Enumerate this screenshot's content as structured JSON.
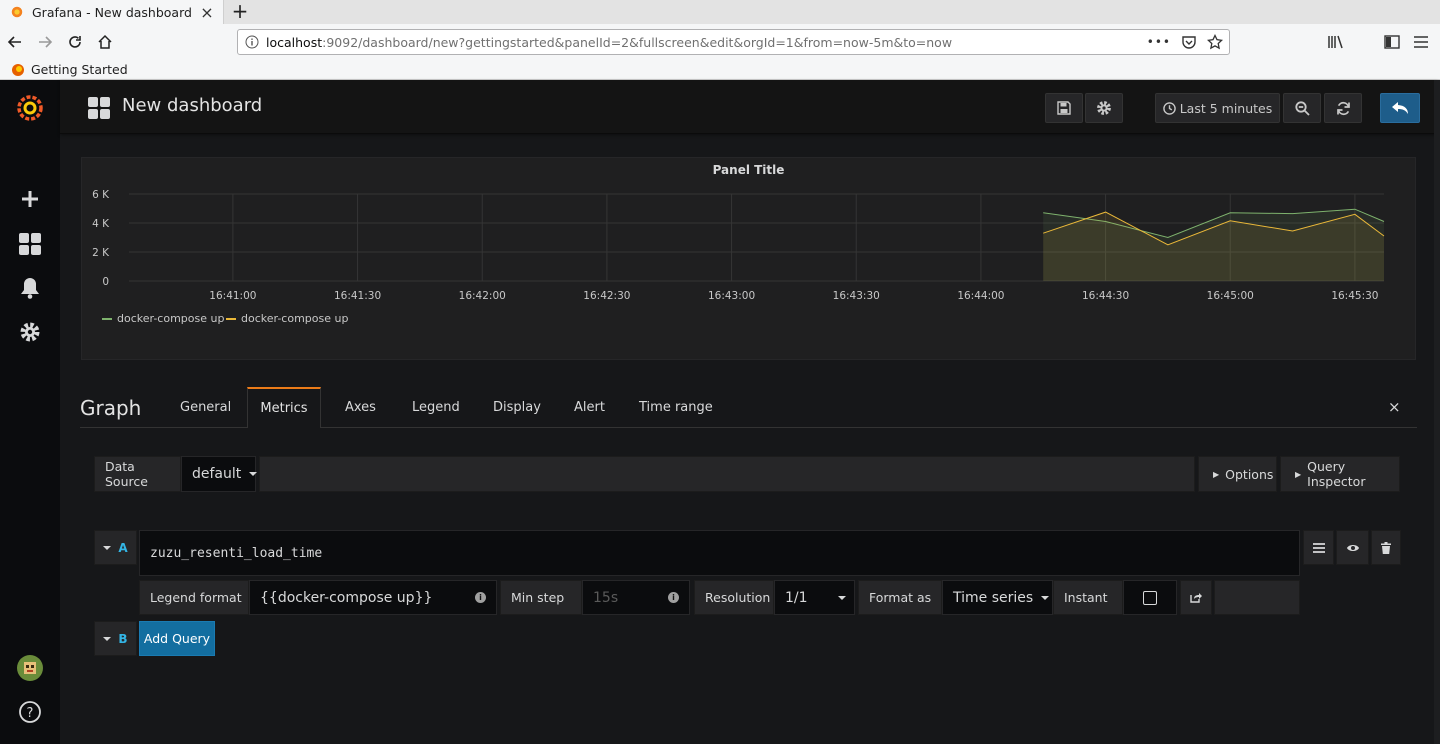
{
  "browser": {
    "tab_title": "Grafana - New dashboard",
    "url_host": "localhost",
    "url_rest": ":9092/dashboard/new?gettingstarted&panelId=2&fullscreen&edit&orgId=1&from=now-5m&to=now",
    "url_more": "•••",
    "bookmark": "Getting Started"
  },
  "header": {
    "title": "New dashboard",
    "time_range": "Last 5 minutes"
  },
  "panel": {
    "title": "Panel Title"
  },
  "chart_data": {
    "type": "line",
    "title": "Panel Title",
    "xlabel": "",
    "ylabel": "",
    "y_ticks": [
      "0",
      "2 K",
      "4 K",
      "6 K"
    ],
    "x_ticks": [
      "16:41:00",
      "16:41:30",
      "16:42:00",
      "16:42:30",
      "16:43:00",
      "16:43:30",
      "16:44:00",
      "16:44:30",
      "16:45:00",
      "16:45:30"
    ],
    "ylim": [
      0,
      6000
    ],
    "xlim": [
      "16:40:35",
      "16:45:37"
    ],
    "grid": true,
    "legend_position": "bottom-left",
    "x": [
      "16:44:15",
      "16:44:30",
      "16:44:45",
      "16:45:00",
      "16:45:15",
      "16:45:30",
      "16:45:37"
    ],
    "series": [
      {
        "name": "docker-compose up",
        "color": "#7eb26d",
        "values": [
          4700,
          4100,
          3000,
          4700,
          4650,
          4950,
          4100
        ]
      },
      {
        "name": "docker-compose up",
        "color": "#eab839",
        "values": [
          3300,
          4750,
          2500,
          4150,
          3450,
          4600,
          3100
        ]
      }
    ]
  },
  "editor": {
    "title": "Graph",
    "tabs": [
      "General",
      "Metrics",
      "Axes",
      "Legend",
      "Display",
      "Alert",
      "Time range"
    ],
    "active_tab": "Metrics",
    "close_icon": "×"
  },
  "datasource": {
    "label": "Data Source",
    "value": "default",
    "options_label": "Options",
    "inspector_label": "Query Inspector"
  },
  "queries": [
    {
      "letter": "A",
      "expression": "zuzu_resenti_load_time",
      "legend_format_label": "Legend format",
      "legend_format_value": "{{docker-compose up}}",
      "min_step_label": "Min step",
      "min_step_placeholder": "15s",
      "resolution_label": "Resolution",
      "resolution_value": "1/1",
      "format_as_label": "Format as",
      "format_as_value": "Time series",
      "instant_label": "Instant",
      "instant_checked": false
    },
    {
      "letter": "B",
      "add_label": "Add Query"
    }
  ],
  "colors": {
    "accent": "#eb7b18",
    "primary_button": "#136ea0",
    "query_letter": "#33b5e5"
  }
}
